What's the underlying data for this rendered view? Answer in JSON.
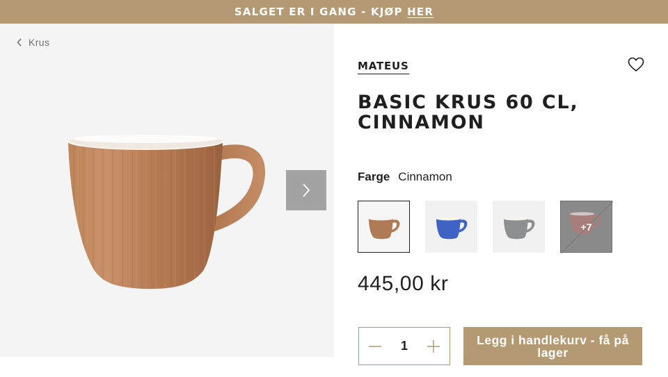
{
  "promo": {
    "text": "SALGET ER I GANG - KJØP",
    "link": "HER"
  },
  "breadcrumb": {
    "label": "Krus"
  },
  "gallery": {
    "next_icon": "chevron-right-icon"
  },
  "product": {
    "brand": "MATEUS",
    "title": "BASIC KRUS 60 CL, CINNAMON",
    "color_label": "Farge",
    "color_value": "Cinnamon",
    "swatches": [
      {
        "color": "#b07a55",
        "selected": true
      },
      {
        "color": "#3f63c4",
        "selected": false
      },
      {
        "color": "#8c9091",
        "selected": false
      },
      {
        "color": "#b27b78",
        "selected": false,
        "more": "+7"
      }
    ],
    "price": "445,00 kr",
    "quantity": "1",
    "add_to_cart": "Legg i handlekurv - få på lager"
  },
  "colors": {
    "accent": "#b49a72",
    "gallery_bg": "#f4f4f4",
    "text": "#1f1f1f"
  }
}
